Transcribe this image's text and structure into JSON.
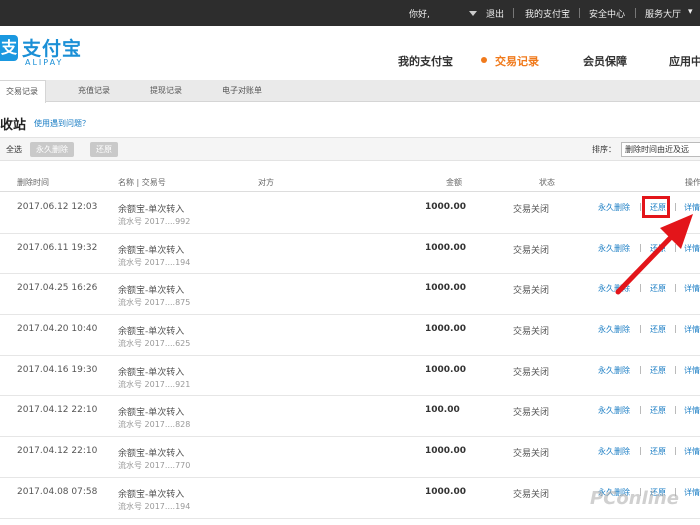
{
  "topbar": {
    "greeting": "你好,",
    "links": [
      "退出",
      "我的支付宝",
      "安全中心",
      "服务大厅"
    ],
    "last_arrow": "▾"
  },
  "header": {
    "logo_mark": "支",
    "logo_text": "支付宝",
    "logo_sub": "ALIPAY",
    "nav": [
      "我的支付宝",
      "交易记录",
      "会员保障",
      "应用中"
    ],
    "active_nav": "交易记录",
    "accent_color": "#f07a1c",
    "brand_color": "#1a8fd6"
  },
  "subtabs": [
    "交易记录",
    "充值记录",
    "提现记录",
    "电子对账单"
  ],
  "page": {
    "title": "收站",
    "help_link": "使用遇到问题？"
  },
  "toolbar": {
    "select_all": "全选",
    "delete_button": "永久删除",
    "restore_button": "还原",
    "sort_label": "排序：",
    "sort_value": "删除时间由近及远"
  },
  "table": {
    "headers": [
      "删除时间",
      "名称 | 交易号",
      "对方",
      "金额",
      "状态",
      "操作"
    ],
    "rows": [
      {
        "date": "2017.06.12 12:03",
        "name": "余额宝-单次转入",
        "serial": "流水号 2017....992",
        "amount": "1000.00",
        "status": "交易关闭",
        "act_delete": "永久删除",
        "act_restore": "还原",
        "act_detail": "详情"
      },
      {
        "date": "2017.06.11 19:32",
        "name": "余额宝-单次转入",
        "serial": "流水号 2017....194",
        "amount": "1000.00",
        "status": "交易关闭",
        "act_delete": "永久删除",
        "act_restore": "还原",
        "act_detail": "详情"
      },
      {
        "date": "2017.04.25 16:26",
        "name": "余额宝-单次转入",
        "serial": "流水号 2017....875",
        "amount": "1000.00",
        "status": "交易关闭",
        "act_delete": "永久删除",
        "act_restore": "还原",
        "act_detail": "详情"
      },
      {
        "date": "2017.04.20 10:40",
        "name": "余额宝-单次转入",
        "serial": "流水号 2017....625",
        "amount": "1000.00",
        "status": "交易关闭",
        "act_delete": "永久删除",
        "act_restore": "还原",
        "act_detail": "详情"
      },
      {
        "date": "2017.04.16 19:30",
        "name": "余额宝-单次转入",
        "serial": "流水号 2017....921",
        "amount": "1000.00",
        "status": "交易关闭",
        "act_delete": "永久删除",
        "act_restore": "还原",
        "act_detail": "详情"
      },
      {
        "date": "2017.04.12 22:10",
        "name": "余额宝-单次转入",
        "serial": "流水号 2017....828",
        "amount": "100.00",
        "status": "交易关闭",
        "act_delete": "永久删除",
        "act_restore": "还原",
        "act_detail": "详情"
      },
      {
        "date": "2017.04.12 22:10",
        "name": "余额宝-单次转入",
        "serial": "流水号 2017....770",
        "amount": "1000.00",
        "status": "交易关闭",
        "act_delete": "永久删除",
        "act_restore": "还原",
        "act_detail": "详情"
      },
      {
        "date": "2017.04.08 07:58",
        "name": "余额宝-单次转入",
        "serial": "流水号 2017....194",
        "amount": "1000.00",
        "status": "交易关闭",
        "act_delete": "永久删除",
        "act_restore": "还原",
        "act_detail": "详情"
      }
    ]
  },
  "annotation_color": "#e3151a",
  "watermark": "PConline"
}
